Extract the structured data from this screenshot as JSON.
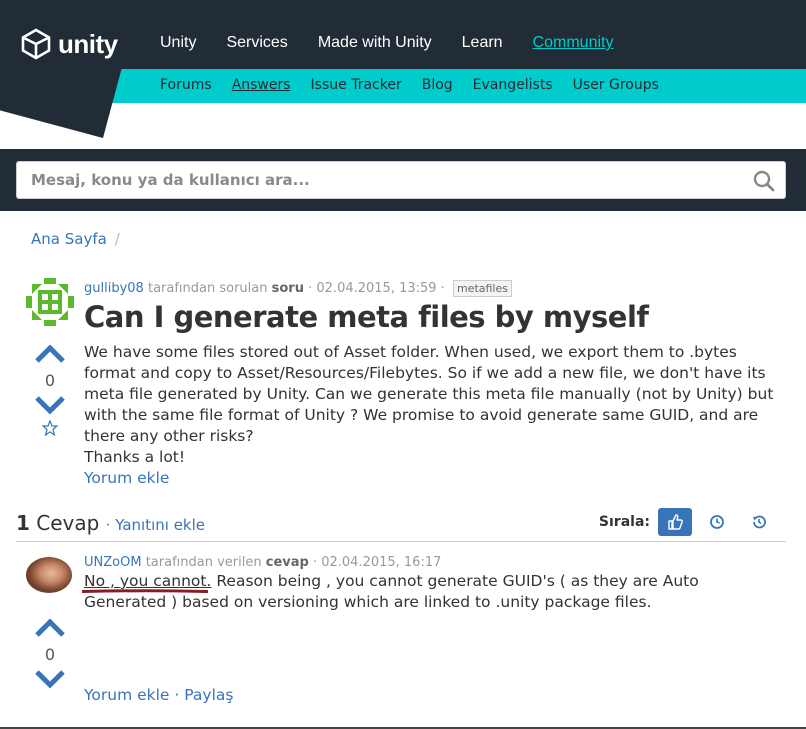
{
  "header": {
    "logo_text": "unity",
    "nav_main": [
      "Unity",
      "Services",
      "Made with Unity",
      "Learn",
      "Community"
    ],
    "nav_sub": [
      "Forums",
      "Answers",
      "Issue Tracker",
      "Blog",
      "Evangelists",
      "User Groups"
    ],
    "colors": {
      "dark": "#222c37",
      "teal": "#00cccc",
      "link": "#3a74b8"
    }
  },
  "search": {
    "placeholder": "Mesaj, konu ya da kullanıcı ara..."
  },
  "breadcrumb": {
    "home": "Ana Sayfa",
    "separator": "/"
  },
  "question": {
    "author": "gulliby08",
    "by_text": "tarafından sorulan",
    "kind": "soru",
    "date": "· 02.04.2015, 13:59 ·",
    "tag": "metafiles",
    "title": "Can I generate meta files by myself",
    "body": "We have some files stored out of Asset folder. When used, we export them to .bytes format and copy to Asset/Resources/Filebytes. So if we add a new file, we don't have its meta file generated by Unity. Can we generate this meta file manually (not by Unity) but with the same file format of Unity ? We promise to avoid generate same GUID, and are there any other risks?",
    "thanks": "Thanks a lot!",
    "add_comment": "Yorum ekle",
    "votes": "0"
  },
  "answers": {
    "count": "1",
    "count_label": "Cevap",
    "add_answer": "· Yanıtını ekle",
    "sort_label": "Sırala:"
  },
  "answer": {
    "author": "UNZoOM",
    "by_text": "tarafından verilen",
    "kind": "cevap",
    "date": "· 02.04.2015, 16:17",
    "highlight": "No , you cannot.",
    "body": " Reason being , you cannot generate GUID's ( as they are Auto Generated ) based on versioning which are linked to .unity package files.",
    "votes": "0",
    "add_comment": "Yorum ekle",
    "separator": " · ",
    "share": "Paylaş"
  }
}
